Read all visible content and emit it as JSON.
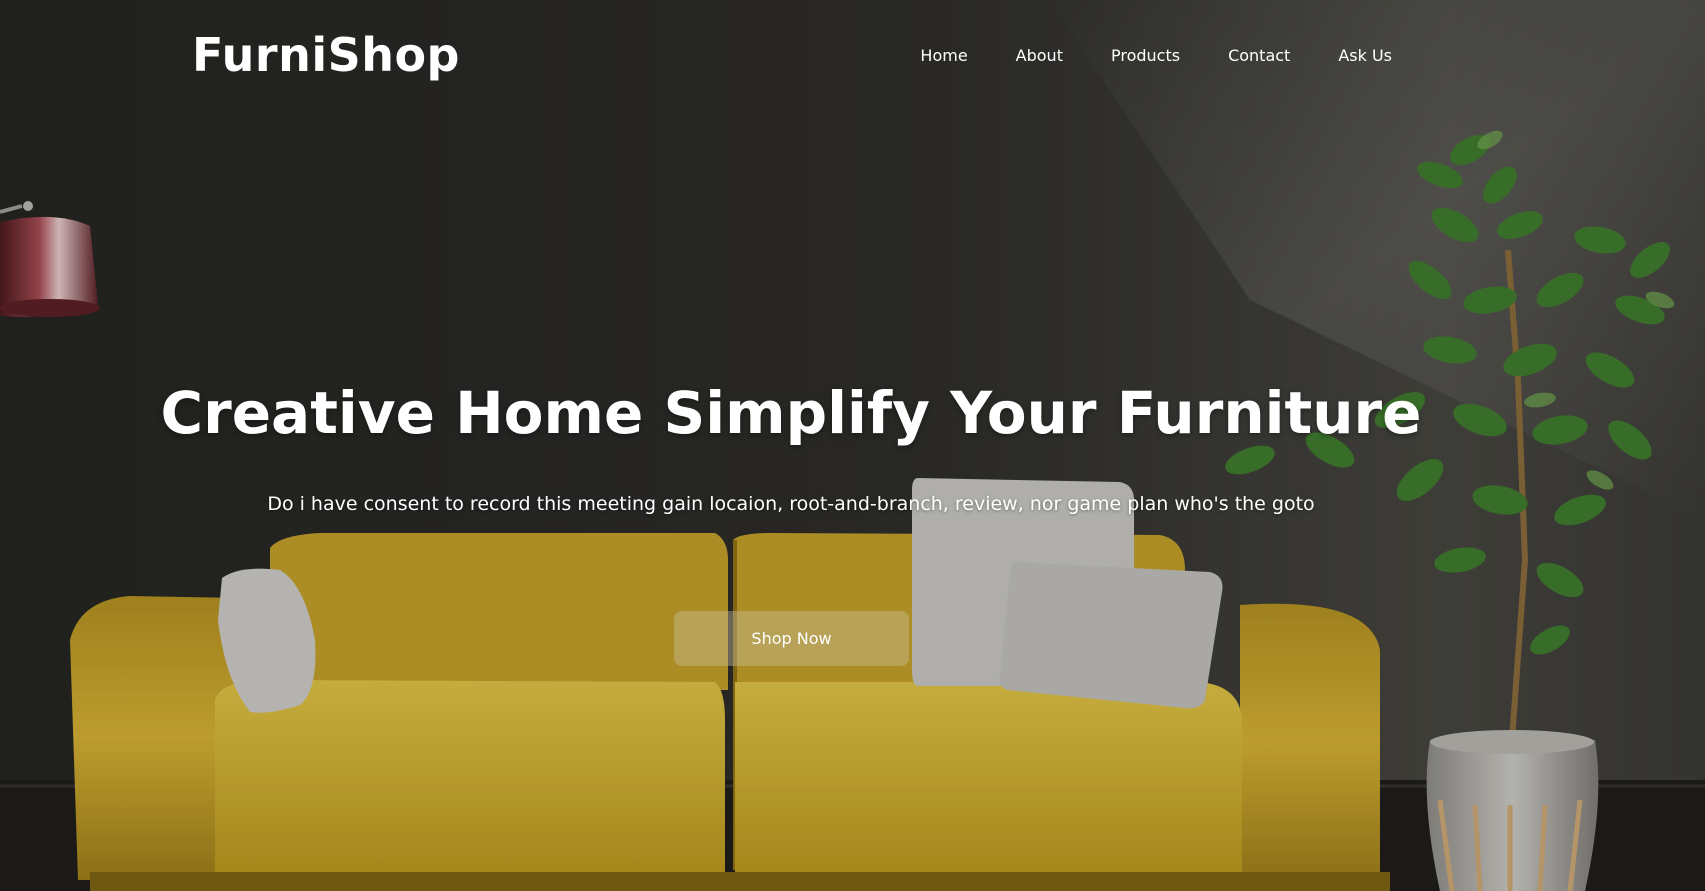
{
  "brand": {
    "name": "FurniShop"
  },
  "nav": {
    "items": [
      {
        "label": "Home"
      },
      {
        "label": "About"
      },
      {
        "label": "Products"
      },
      {
        "label": "Contact"
      },
      {
        "label": "Ask Us"
      }
    ]
  },
  "hero": {
    "headline": "Creative Home Simplify Your Furniture",
    "subtitle": "Do i have consent to record this meeting gain locaion, root-and-branch, review, nor game plan who's the goto",
    "cta_label": "Shop Now",
    "image_icon": "living-room-photo"
  },
  "colors": {
    "wall": "#2b2a27",
    "sofa": "#c9a62a",
    "pillow": "#cfcfcb",
    "plant": "#3f7a2e",
    "lamp": "#7a2f35",
    "button_bg": "rgba(200,190,160,0.42)",
    "text": "#ffffff"
  }
}
